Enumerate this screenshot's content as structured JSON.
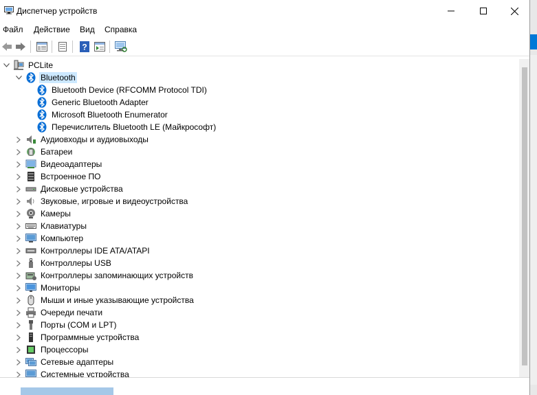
{
  "window": {
    "title": "Диспетчер устройств"
  },
  "menu": [
    "Файл",
    "Действие",
    "Вид",
    "Справка"
  ],
  "toolbar": [
    {
      "name": "back-icon"
    },
    {
      "name": "forward-icon"
    },
    {
      "name": "properties-icon"
    },
    {
      "name": "update-driver-icon"
    },
    {
      "name": "help-icon"
    },
    {
      "name": "action-icon"
    },
    {
      "name": "scan-hardware-icon"
    }
  ],
  "tree": {
    "root": "PCLite",
    "expanded_category": "Bluetooth",
    "bluetooth_devices": [
      "Bluetooth Device (RFCOMM Protocol TDI)",
      "Generic Bluetooth Adapter",
      "Microsoft Bluetooth Enumerator",
      "Перечислитель Bluetooth LE (Майкрософт)"
    ],
    "categories": [
      {
        "label": "Аудиовходы и аудиовыходы",
        "icon": "audio-icon"
      },
      {
        "label": "Батареи",
        "icon": "battery-icon"
      },
      {
        "label": "Видеоадаптеры",
        "icon": "display-adapter-icon"
      },
      {
        "label": "Встроенное ПО",
        "icon": "firmware-icon"
      },
      {
        "label": "Дисковые устройства",
        "icon": "disk-icon"
      },
      {
        "label": "Звуковые, игровые и видеоустройства",
        "icon": "speaker-icon"
      },
      {
        "label": "Камеры",
        "icon": "camera-icon"
      },
      {
        "label": "Клавиатуры",
        "icon": "keyboard-icon"
      },
      {
        "label": "Компьютер",
        "icon": "computer-icon"
      },
      {
        "label": "Контроллеры IDE ATA/ATAPI",
        "icon": "ide-controller-icon"
      },
      {
        "label": "Контроллеры USB",
        "icon": "usb-icon"
      },
      {
        "label": "Контроллеры запоминающих устройств",
        "icon": "storage-controller-icon"
      },
      {
        "label": "Мониторы",
        "icon": "monitor-icon"
      },
      {
        "label": "Мыши и иные указывающие устройства",
        "icon": "mouse-icon"
      },
      {
        "label": "Очереди печати",
        "icon": "printer-icon"
      },
      {
        "label": "Порты (COM и LPT)",
        "icon": "port-icon"
      },
      {
        "label": "Программные устройства",
        "icon": "software-device-icon"
      },
      {
        "label": "Процессоры",
        "icon": "processor-icon"
      },
      {
        "label": "Сетевые адаптеры",
        "icon": "network-adapter-icon"
      },
      {
        "label": "Системные устройства",
        "icon": "system-device-icon"
      }
    ]
  },
  "colors": {
    "bluetooth": "#0a6fd6",
    "selection": "#cce8ff"
  }
}
